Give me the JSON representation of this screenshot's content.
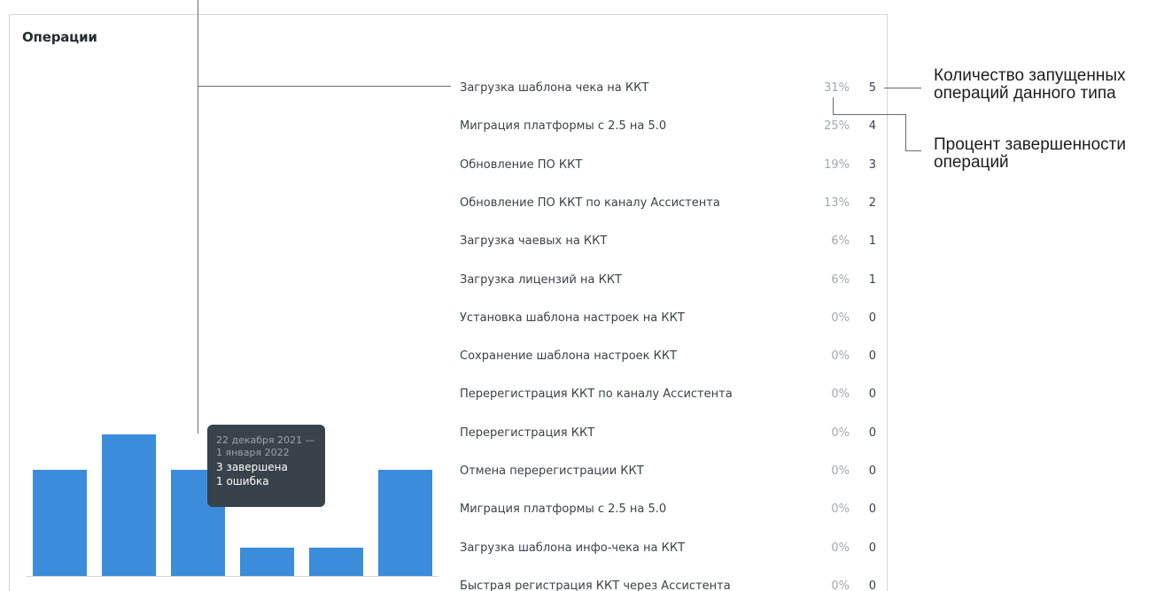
{
  "panel": {
    "title": "Операции"
  },
  "operations": [
    {
      "name": "Загрузка шаблона чека на ККТ",
      "percent": "31%",
      "count": "5"
    },
    {
      "name": "Миграция платформы с 2.5 на 5.0",
      "percent": "25%",
      "count": "4"
    },
    {
      "name": "Обновление ПО ККТ",
      "percent": "19%",
      "count": "3"
    },
    {
      "name": "Обновление ПО ККТ по каналу Ассистента",
      "percent": "13%",
      "count": "2"
    },
    {
      "name": "Загрузка чаевых на ККТ",
      "percent": "6%",
      "count": "1"
    },
    {
      "name": "Загрузка лицензий на ККТ",
      "percent": "6%",
      "count": "1"
    },
    {
      "name": "Установка шаблона настроек на ККТ",
      "percent": "0%",
      "count": "0"
    },
    {
      "name": "Сохранение шаблона настроек ККТ",
      "percent": "0%",
      "count": "0"
    },
    {
      "name": "Перерегистрация ККТ по каналу Ассистента",
      "percent": "0%",
      "count": "0"
    },
    {
      "name": "Перерегистрация ККТ",
      "percent": "0%",
      "count": "0"
    },
    {
      "name": "Отмена перерегистрации ККТ",
      "percent": "0%",
      "count": "0"
    },
    {
      "name": "Миграция платформы с 2.5 на 5.0",
      "percent": "0%",
      "count": "0"
    },
    {
      "name": "Загрузка шаблона инфо-чека на ККТ",
      "percent": "0%",
      "count": "0"
    },
    {
      "name": "Быстрая регистрация ККТ через Ассистента",
      "percent": "0%",
      "count": "0"
    }
  ],
  "chart_data": {
    "type": "bar",
    "values": [
      3,
      4,
      3,
      0.8,
      0.8,
      3
    ],
    "ylim": [
      0,
      5
    ],
    "bar_color": "#3b8ddb"
  },
  "tooltip": {
    "date_line1": "22 декабря 2021 —",
    "date_line2": "1 января 2022",
    "completed": "3 завершена",
    "errors": "1 ошибка"
  },
  "annotations": {
    "count_label_line1": "Количество запущенных",
    "count_label_line2": "операций данного типа",
    "percent_label_line1": "Процент завершенности",
    "percent_label_line2": "операций"
  },
  "colors": {
    "accent": "#3b8ddb",
    "tooltip_bg": "#37424a",
    "muted_text": "#a2a8ac"
  }
}
